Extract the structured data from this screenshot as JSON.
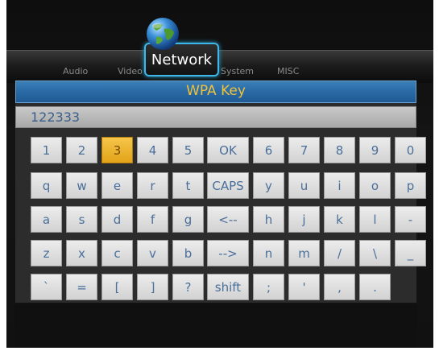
{
  "menu": {
    "tabs": [
      "Audio",
      "Video",
      "Network",
      "System",
      "MISC"
    ],
    "active": "Network"
  },
  "dialog": {
    "title": "WPA Key",
    "input_value": "122333"
  },
  "keyboard": {
    "rows": [
      [
        "1",
        "2",
        "3",
        "4",
        "5",
        "OK",
        "6",
        "7",
        "8",
        "9",
        "0"
      ],
      [
        "q",
        "w",
        "e",
        "r",
        "t",
        "CAPS",
        "y",
        "u",
        "i",
        "o",
        "p"
      ],
      [
        "a",
        "s",
        "d",
        "f",
        "g",
        "<--",
        "h",
        "j",
        "k",
        "l",
        "-"
      ],
      [
        "z",
        "x",
        "c",
        "v",
        "b",
        "-->",
        "n",
        "m",
        "/",
        "\\",
        "_"
      ],
      [
        "`",
        "=",
        "[",
        "]",
        "?",
        "shift",
        ";",
        "'",
        ",",
        "."
      ]
    ],
    "selected": "3"
  },
  "colors": {
    "title_bar": "#2a6aa5",
    "title_text": "#f0c13a",
    "selected_key": "#f6c64a",
    "key_text": "#4a6f9a",
    "active_tab_border": "#3fb7e8"
  },
  "icons": {
    "network": "globe-icon"
  }
}
